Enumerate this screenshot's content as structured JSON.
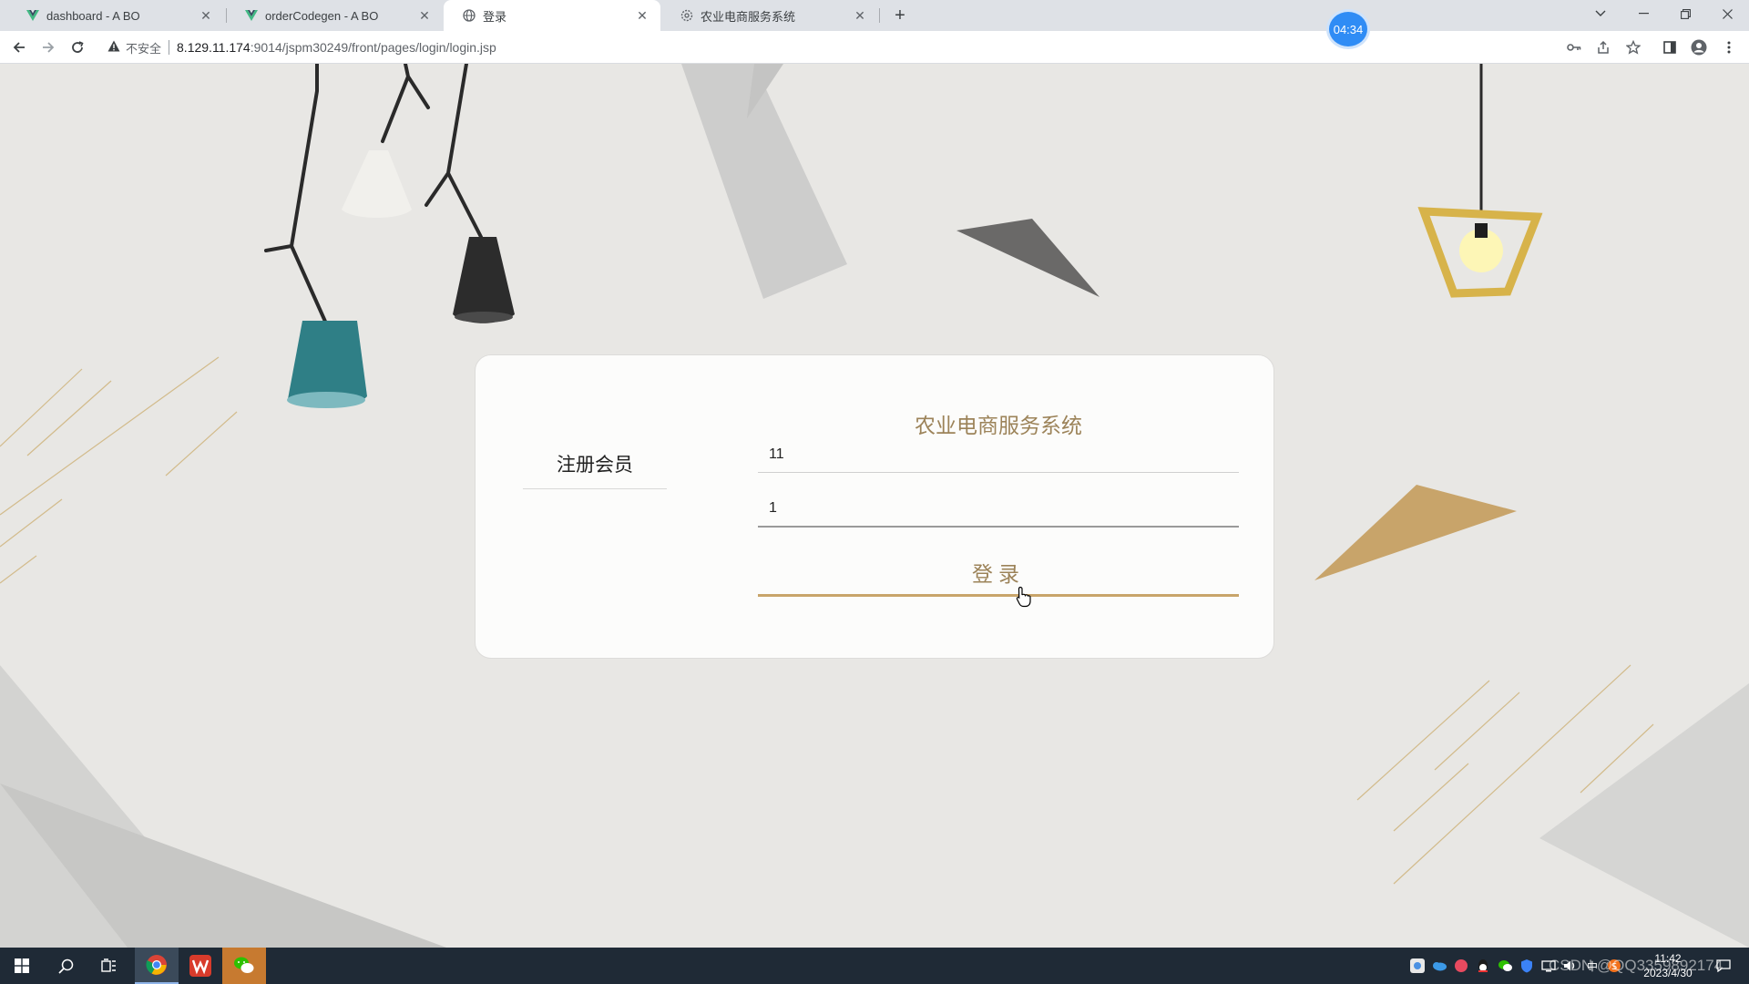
{
  "browser": {
    "tabs": [
      {
        "title": "dashboard - A BO",
        "icon": "vue-icon"
      },
      {
        "title": "orderCodegen - A BO",
        "icon": "vue-icon"
      },
      {
        "title": "登录",
        "icon": "globe-icon",
        "active": true
      },
      {
        "title": "农业电商服务系统",
        "icon": "gear-icon"
      }
    ],
    "timer_badge": "04:34",
    "address": {
      "security_label": "不安全",
      "host": "8.129.11.174",
      "path": ":9014/jspm30249/front/pages/login/login.jsp"
    }
  },
  "login": {
    "system_title": "农业电商服务系统",
    "register_label": "注册会员",
    "username_value": "11",
    "password_value": "1",
    "login_button_label": "登录"
  },
  "taskbar": {
    "time": "11:42",
    "date": "2023/4/30",
    "tray_text": "中",
    "watermark": "CSDN @QQ3359892174"
  },
  "colors": {
    "accent_gold": "#c8a46a",
    "title_brown": "#9c8359",
    "page_bg": "#e8e7e4"
  }
}
